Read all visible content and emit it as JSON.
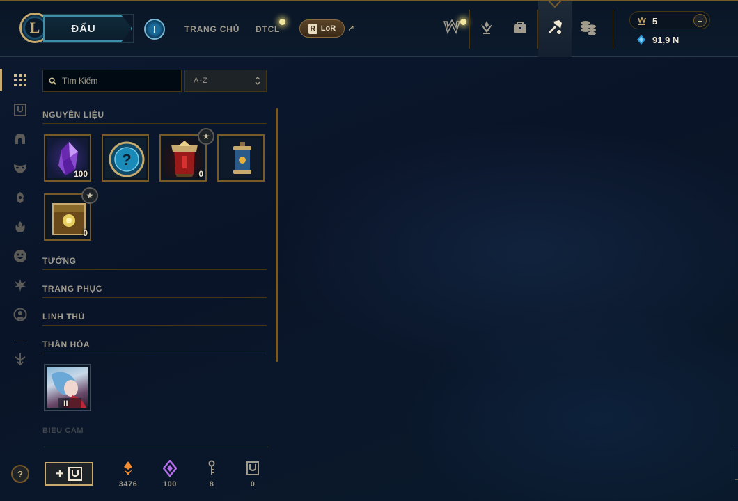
{
  "header": {
    "logo_letter": "L",
    "play_label": "ĐẤU",
    "nav": [
      {
        "label": "TRANG CHỦ"
      },
      {
        "label": "ĐTCL"
      }
    ],
    "lor_label": "LoR",
    "lor_badge": "R",
    "external_arrow": "↗",
    "icons": [
      {
        "name": "worlds-icon",
        "notify": true
      },
      {
        "name": "ranked-emblem-icon"
      },
      {
        "name": "collection-bag-icon"
      },
      {
        "name": "loot-crafting-icon",
        "active": true
      },
      {
        "name": "store-coins-icon"
      }
    ],
    "currency": {
      "rp_value": "5",
      "blue_essence_value": "91,9 N",
      "add_label": "+"
    }
  },
  "sidebar": {
    "icons": [
      {
        "name": "all-items-grid-icon",
        "active": true
      },
      {
        "name": "chest-icon"
      },
      {
        "name": "champion-helmet-icon"
      },
      {
        "name": "skin-mask-icon"
      },
      {
        "name": "ward-icon"
      },
      {
        "name": "eternals-flame-icon"
      },
      {
        "name": "emote-face-icon"
      },
      {
        "name": "summoner-icon-tree-icon"
      },
      {
        "name": "profile-icon"
      },
      {
        "name": "disenchant-icon"
      }
    ]
  },
  "search": {
    "placeholder": "Tìm Kiếm",
    "sort_value": "A-Z",
    "sort_arrows": "⌃⌄"
  },
  "sections": [
    {
      "title": "NGUYÊN LIỆU",
      "items": [
        {
          "name": "mythic-essence-item",
          "count": "100",
          "star": false
        },
        {
          "name": "mystery-icon-item",
          "count": "",
          "star": false
        },
        {
          "name": "masterwork-chest-item",
          "count": "0",
          "star": true
        },
        {
          "name": "capsule-item",
          "count": "",
          "star": false
        },
        {
          "name": "hextech-chest-item",
          "count": "0",
          "star": true
        }
      ]
    },
    {
      "title": "TƯỚNG"
    },
    {
      "title": "TRANG PHỤC"
    },
    {
      "title": "LINH THÚ"
    },
    {
      "title": "THẦN HỎA",
      "items": [
        {
          "name": "eternals-series-item",
          "count": "II"
        }
      ]
    },
    {
      "title": "BIỂU CẢM"
    }
  ],
  "footer": {
    "help_label": "?",
    "craft_plus": "+",
    "currencies": [
      {
        "name": "orange-essence-icon",
        "value": "3476",
        "color": "#f08c34"
      },
      {
        "name": "mythic-essence-icon",
        "value": "100",
        "color": "#b46eea"
      },
      {
        "name": "key-fragment-icon",
        "value": "8",
        "color": "#a09b8c"
      },
      {
        "name": "chest-count-icon",
        "value": "0",
        "color": "#a09b8c"
      }
    ]
  },
  "colors": {
    "gold": "#c8aa6e",
    "gold_dark": "#785a28",
    "text_muted": "#a09b8c",
    "background": "#0a1428"
  }
}
